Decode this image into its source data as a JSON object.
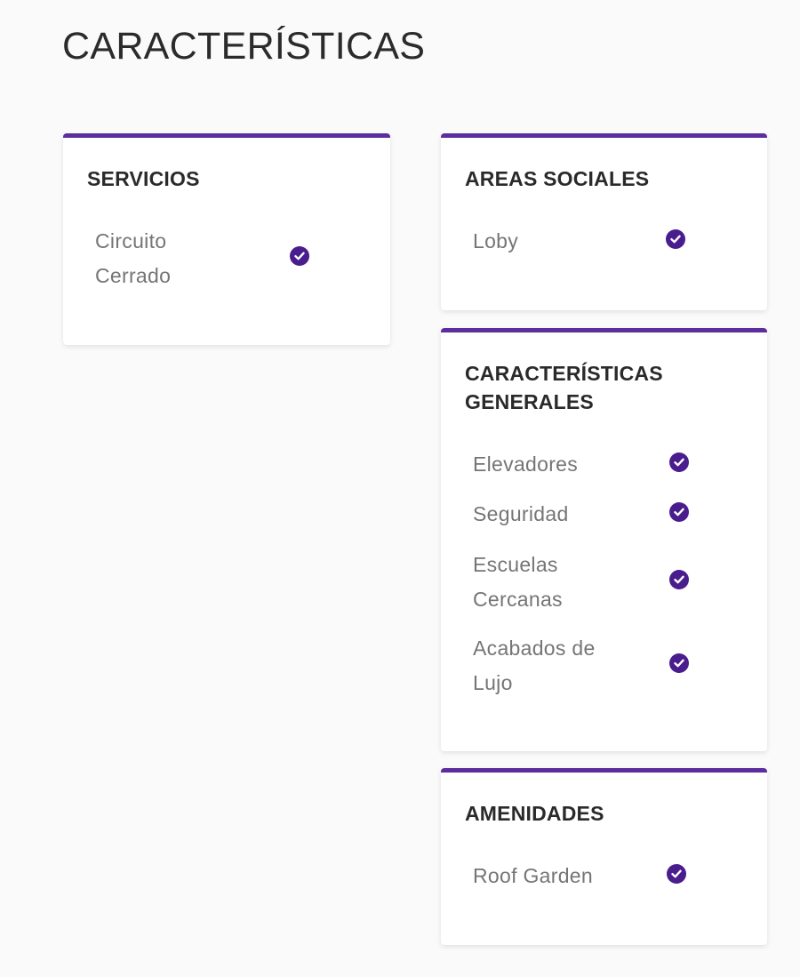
{
  "page": {
    "title": "CARACTERÍSTICAS"
  },
  "theme": {
    "accent": "#5c2d9e",
    "check_bg": "#4a1d8f",
    "text_label": "#757575",
    "text_heading": "#2a2a2a"
  },
  "cards": {
    "servicios": {
      "title": "SERVICIOS",
      "items": [
        {
          "label": "Circuito Cerrado",
          "checked": true,
          "icon": "check-circle-icon"
        }
      ]
    },
    "areas_sociales": {
      "title": "AREAS SOCIALES",
      "items": [
        {
          "label": "Loby",
          "checked": true,
          "icon": "check-circle-icon"
        }
      ]
    },
    "caracteristicas_generales": {
      "title": "CARACTERÍSTICAS GENERALES",
      "items": [
        {
          "label": "Elevadores",
          "checked": true,
          "icon": "check-circle-icon"
        },
        {
          "label": "Seguridad",
          "checked": true,
          "icon": "check-circle-icon"
        },
        {
          "label": "Escuelas Cercanas",
          "checked": true,
          "icon": "check-circle-icon"
        },
        {
          "label": "Acabados de Lujo",
          "checked": true,
          "icon": "check-circle-icon"
        }
      ]
    },
    "amenidades": {
      "title": "AMENIDADES",
      "items": [
        {
          "label": "Roof Garden",
          "checked": true,
          "icon": "check-circle-icon"
        }
      ]
    }
  }
}
